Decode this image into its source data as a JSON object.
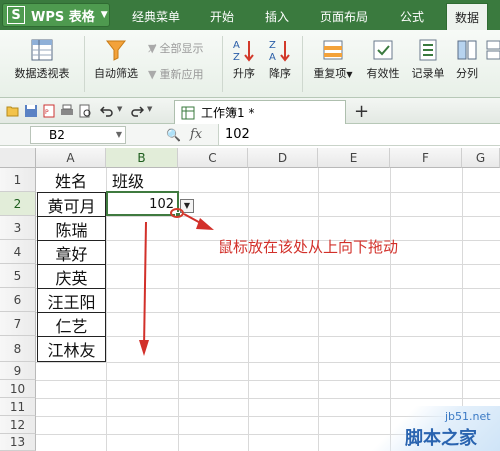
{
  "menu": {
    "app_logo": "S",
    "app_name": "WPS 表格",
    "tabs": [
      "经典菜单",
      "开始",
      "插入",
      "页面布局",
      "公式",
      "数据"
    ],
    "active_tab": "数据"
  },
  "ribbon": {
    "pivot_table": "数据透视表",
    "auto_filter": "自动筛选",
    "show_all": "全部显示",
    "reapply": "重新应用",
    "sort_asc": "升序",
    "sort_desc": "降序",
    "duplicates": "重复项",
    "validation": "有效性",
    "record_list": "记录单",
    "split": "分列"
  },
  "toolbar": {
    "doc_tab_title": "工作簿1 *",
    "add_tab_symbol": "+"
  },
  "formula_bar": {
    "name_box": "B2",
    "fx_label": "fx",
    "value": "102"
  },
  "sheet": {
    "columns": [
      "A",
      "B",
      "C",
      "D",
      "E",
      "F",
      "G"
    ],
    "rows": [
      "1",
      "2",
      "3",
      "4",
      "5",
      "6",
      "7",
      "8",
      "9",
      "10",
      "11",
      "12",
      "13"
    ],
    "header_name": "姓名",
    "header_class": "班级",
    "names": [
      "黄可月",
      "陈瑞",
      "章好",
      "庆英",
      "汪王阳",
      "仁艺",
      "江林友"
    ],
    "b2_value": "102"
  },
  "annotation": {
    "text": "鼠标放在该处从上向下拖动",
    "color": "#d2302a"
  },
  "watermark": {
    "url": "jb51.net",
    "name": "脚本之家"
  },
  "colors": {
    "menu_bar": "#3a7a3e",
    "selection_border": "#3f7a3f",
    "annotation_red": "#d2302a"
  }
}
